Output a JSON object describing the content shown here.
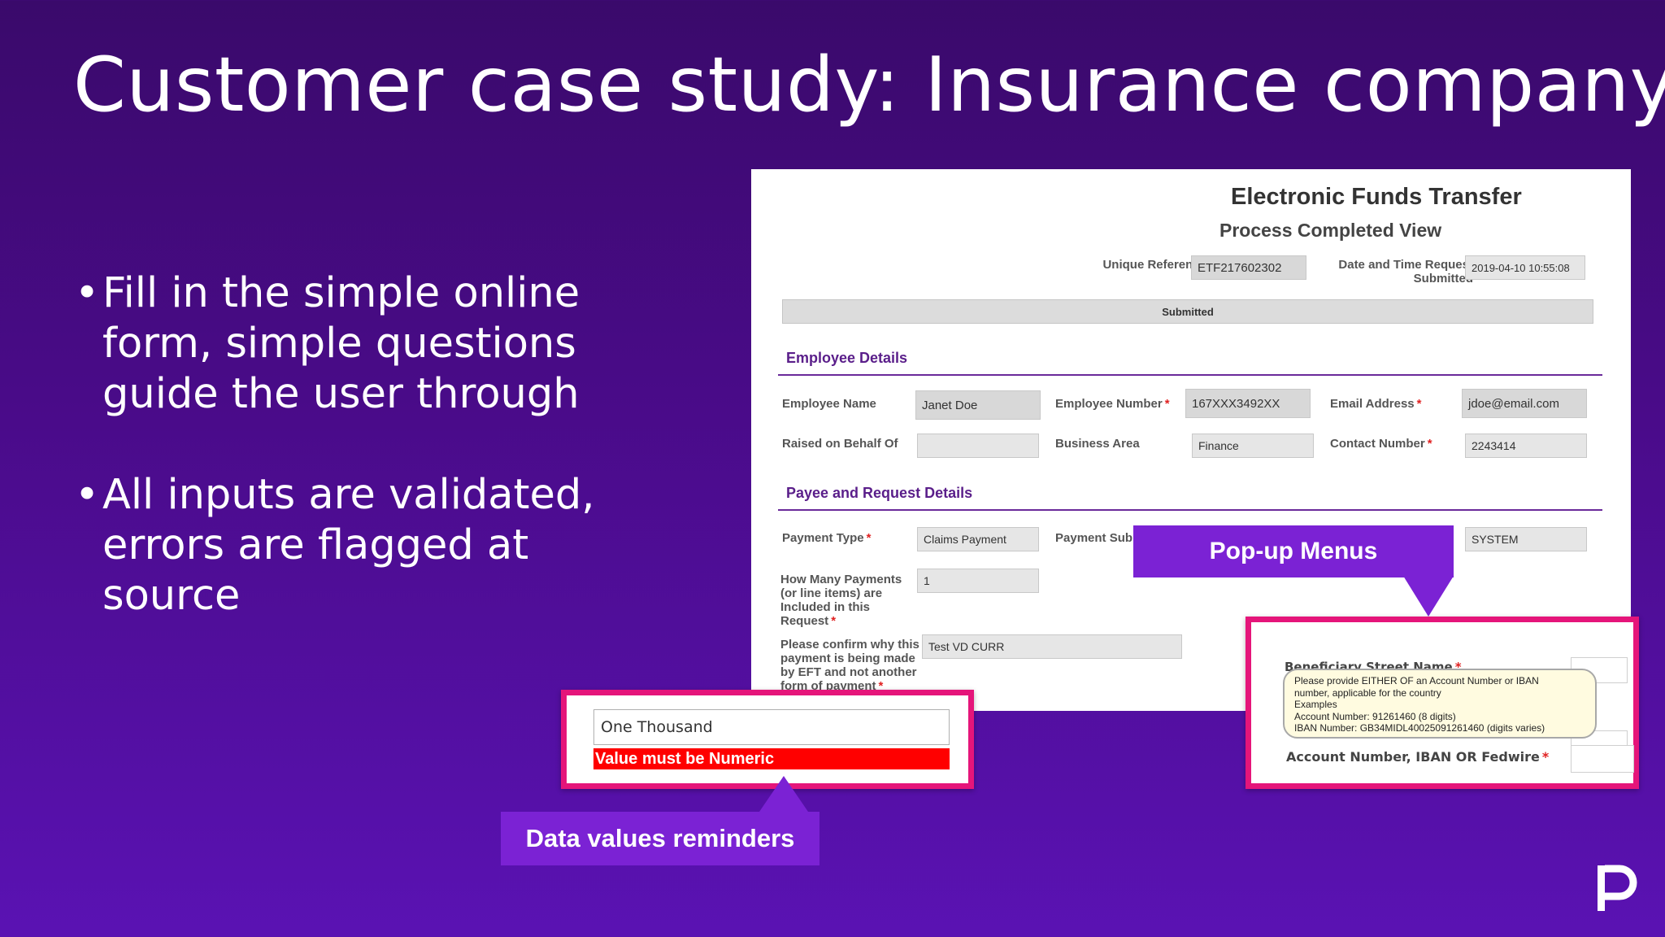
{
  "slide": {
    "title": "Customer case study: Insurance company",
    "bullets": [
      "Fill in the simple online form, simple questions guide the user through",
      "All inputs are validated, errors are flagged at source"
    ],
    "bullet_char": "•",
    "logo_icon": "p-logo"
  },
  "form": {
    "title": "Electronic Funds Transfer",
    "subtitle": "Process Completed View",
    "unique_reference_label": "Unique Reference",
    "unique_reference_value": "ETF217602302",
    "date_label": "Date and Time Request Submitted",
    "date_value": "2019-04-10 10:55:08",
    "status": "Submitted",
    "employee_section": "Employee Details",
    "employee_name_label": "Employee Name",
    "employee_name_value": "Janet Doe",
    "employee_number_label": "Employee Number",
    "employee_number_value": "167XXX3492XX",
    "email_label": "Email Address",
    "email_value": "jdoe@email.com",
    "raised_on_behalf_label": "Raised on Behalf Of",
    "raised_on_behalf_value": "",
    "business_area_label": "Business Area",
    "business_area_value": "Finance",
    "contact_number_label": "Contact Number",
    "contact_number_value": "2243414",
    "payee_section": "Payee and Request Details",
    "payment_type_label": "Payment Type",
    "payment_type_value": "Claims Payment",
    "payment_sub_label": "Payment Sub",
    "system_value": "SYSTEM",
    "how_many_label": "How Many Payments (or line items) are Included in this Request",
    "how_many_value": "1",
    "confirm_why_label": "Please confirm why this payment is being made by EFT and not another form of payment",
    "confirm_why_value": "Test VD CURR"
  },
  "callouts": {
    "popup_menus_label": "Pop-up Menus",
    "data_values_label": "Data values reminders",
    "numeric_input_value": "One Thousand",
    "numeric_error": "Value must be Numeric",
    "beneficiary_street_label": "Beneficiary Street Name",
    "tooltip_lines": [
      "Please provide EITHER OF an Account Number or IBAN",
      "number, applicable for the country",
      "Examples",
      "Account Number: 91261460 (8 digits)",
      "IBAN Number: GB34MIDL40025091261460 (digits varies)"
    ],
    "account_label": "Account Number, IBAN OR Fedwire"
  },
  "colors": {
    "accent_purple": "#7b22d4",
    "callout_pink": "#e5157a",
    "error_red": "#ff0000",
    "section_purple": "#5a1e8a"
  }
}
